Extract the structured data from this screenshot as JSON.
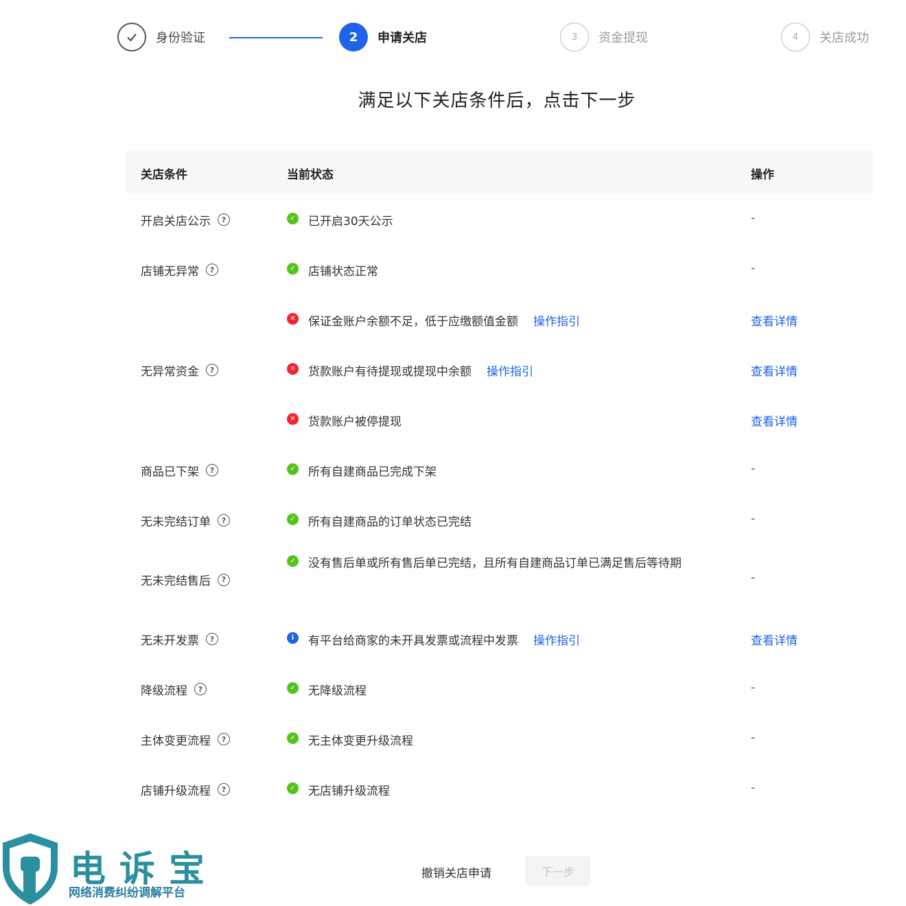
{
  "steps": [
    {
      "number": "",
      "label": "身份验证",
      "state": "done"
    },
    {
      "number": "2",
      "label": "申请关店",
      "state": "active"
    },
    {
      "number": "3",
      "label": "资金提现",
      "state": "todo"
    },
    {
      "number": "4",
      "label": "关店成功",
      "state": "todo"
    }
  ],
  "heading": "满足以下关店条件后，点击下一步",
  "table": {
    "headers": {
      "condition": "关店条件",
      "status": "当前状态",
      "action": "操作"
    },
    "rows": [
      {
        "condition": "开启关店公示",
        "status": "已开启30天公示",
        "status_type": "ok",
        "guide": "",
        "action": "-"
      },
      {
        "condition": "店铺无异常",
        "status": "店铺状态正常",
        "status_type": "ok",
        "guide": "",
        "action": "-"
      },
      {
        "condition": "",
        "status": "保证金账户余额不足，低于应缴额值金额",
        "status_type": "err",
        "guide": "操作指引",
        "action": "查看详情"
      },
      {
        "condition": "无异常资金",
        "status": "货款账户有待提现或提现中余额",
        "status_type": "err",
        "guide": "操作指引",
        "action": "查看详情"
      },
      {
        "condition": "",
        "status": "货款账户被停提现",
        "status_type": "err",
        "guide": "",
        "action": "查看详情"
      },
      {
        "condition": "商品已下架",
        "status": "所有自建商品已完成下架",
        "status_type": "ok",
        "guide": "",
        "action": "-"
      },
      {
        "condition": "无未完结订单",
        "status": "所有自建商品的订单状态已完结",
        "status_type": "ok",
        "guide": "",
        "action": "-"
      },
      {
        "condition": "无未完结售后",
        "status": "没有售后单或所有售后单已完结，且所有自建商品订单已满足售后等待期",
        "status_type": "ok",
        "guide": "",
        "action": "-"
      },
      {
        "condition": "无未开发票",
        "status": "有平台给商家的未开具发票或流程中发票",
        "status_type": "info",
        "guide": "操作指引",
        "action": "查看详情"
      },
      {
        "condition": "降级流程",
        "status": "无降级流程",
        "status_type": "ok",
        "guide": "",
        "action": "-"
      },
      {
        "condition": "主体变更流程",
        "status": "无主体变更升级流程",
        "status_type": "ok",
        "guide": "",
        "action": "-"
      },
      {
        "condition": "店铺升级流程",
        "status": "无店铺升级流程",
        "status_type": "ok",
        "guide": "",
        "action": "-"
      }
    ]
  },
  "footer": {
    "cancel_label": "撤销关店申请",
    "next_label": "下一步"
  },
  "watermark": {
    "title": "电诉宝",
    "subtitle": "网络消费纠纷调解平台"
  },
  "colors": {
    "primary": "#1f63e6",
    "ok": "#52c41a",
    "err": "#f5222d",
    "brand": "#2a8f9e"
  },
  "icons": {
    "ok": "check-circle-icon",
    "err": "close-circle-icon",
    "info": "info-circle-icon",
    "help": "question-circle-icon"
  }
}
